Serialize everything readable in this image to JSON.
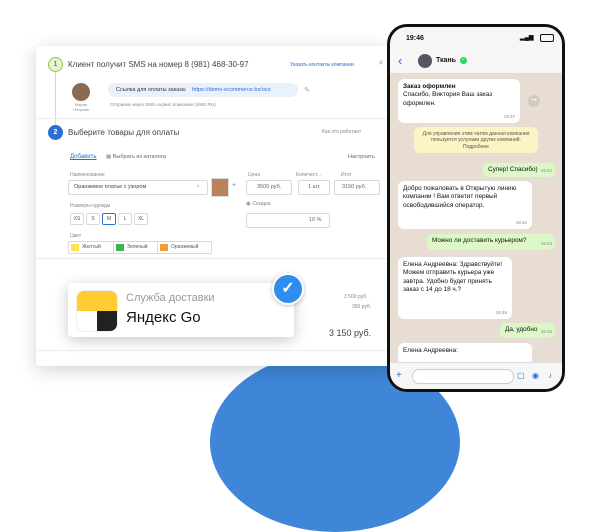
{
  "crm": {
    "step1": {
      "number": "1",
      "title": "Клиент получит SMS на номер 8 (981) 468-30-97",
      "action": "Указать контакты компании",
      "agent_name": "Мария\nПетрова",
      "link_prefix": "Ссылка для оплаты заказа:",
      "link_url": "https://demo-ecommerce.bx/oco",
      "sms_note": "Отправка через SMS-сервис Компания (SMS.RU)"
    },
    "step2": {
      "number": "2",
      "title": "Выберите товары для оплаты",
      "how_link": "Как это работает",
      "add_link": "Добавить",
      "catalog_link": "Выбрать из каталога",
      "settings_link": "Настроить",
      "col_name": "Наименование",
      "col_price": "Цена",
      "col_qty": "Количест...",
      "col_total": "Итог",
      "product_name": "Оранжевое платье с узором",
      "price": "3500 руб.",
      "qty": "1  шт.",
      "total": "3150 руб.",
      "sizes_label": "Размеры одежды",
      "sizes": [
        "XS",
        "S",
        "M",
        "L",
        "XL"
      ],
      "discount_label": "Скидка",
      "discount_value": "10  %",
      "color_label": "Цвет",
      "colors": [
        {
          "label": "Желтый",
          "color": "#ffe54d"
        },
        {
          "label": "Зеленый",
          "color": "#3cb54a"
        },
        {
          "label": "Оранжевый",
          "color": "#f29c38"
        }
      ],
      "sum1": "3 500 руб.",
      "sum2": "350 руб.",
      "total_big": "3 150 руб."
    }
  },
  "delivery_card": {
    "service": "Служба доставки",
    "brand": "Яндекс Go"
  },
  "phone": {
    "time": "19:46",
    "contact": "Ткань",
    "messages": [
      {
        "dir": "in",
        "title": "Заказ оформлен",
        "text": "Спасибо, Виктория Ваш заказ оформлен.",
        "time": "19:37"
      },
      {
        "dir": "sys",
        "text": "Для управления этим чатом данная компания пользуется услугами других компаний. Подробнее"
      },
      {
        "dir": "out",
        "text": "Супер! Спасибо)",
        "time": "19:42"
      },
      {
        "dir": "in",
        "text": "Добро пожаловать в Открытую линию компании ! Вам ответит первый освободившийся оператор.",
        "time": "19:42"
      },
      {
        "dir": "out",
        "text": "Можно ли доставить курьером?",
        "time": "19:43"
      },
      {
        "dir": "in",
        "text": "Елена Андреевна: Здравствуйте! Можем отправить курьера уже завтра. Удобно будет принять заказ с 14 до 18 ч.?",
        "time": "19:45"
      },
      {
        "dir": "out",
        "text": "Да, удобно",
        "time": "19:45"
      },
      {
        "dir": "in",
        "text": "Елена Андреевна:",
        "time": ""
      }
    ]
  }
}
